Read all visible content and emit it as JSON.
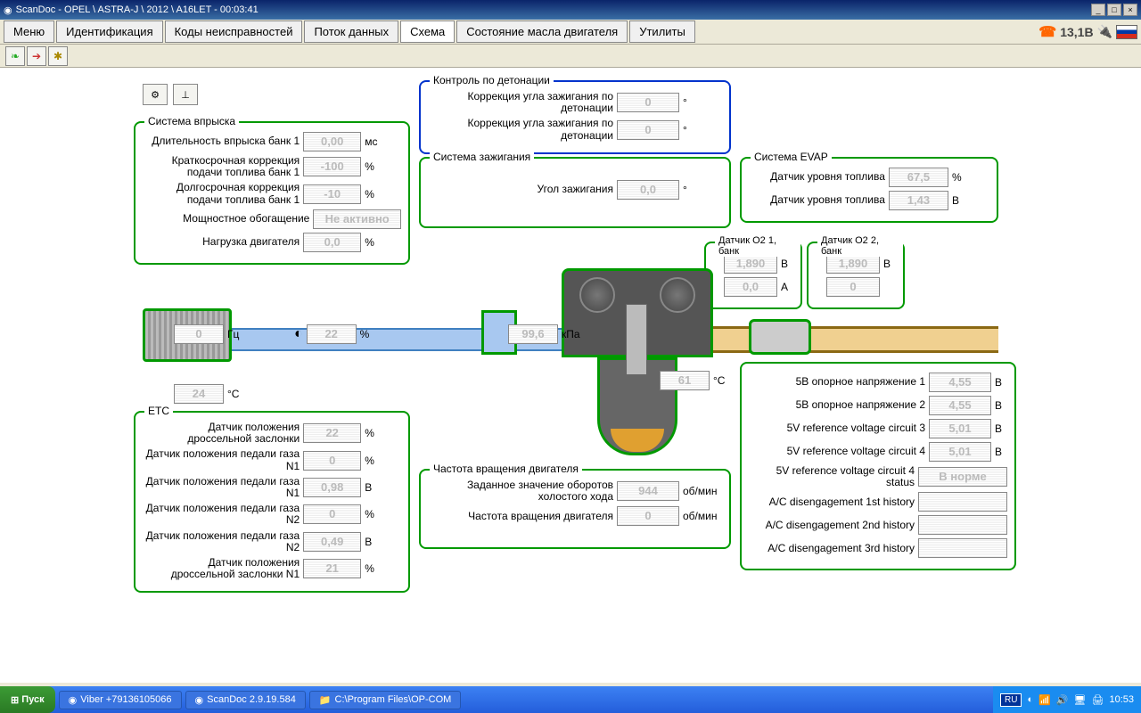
{
  "titlebar": "ScanDoc - OPEL \\ ASTRA-J \\ 2012 \\ A16LET - 00:03:41",
  "menu": {
    "items": [
      "Меню",
      "Идентификация",
      "Коды неисправностей",
      "Поток данных",
      "Схема",
      "Состояние масла двигателя",
      "Утилиты"
    ],
    "voltage": "13,1В"
  },
  "groups": {
    "knock": {
      "title": "Контроль по детонации",
      "r1_lbl": "Коррекция угла зажигания по детонации",
      "r1_val": "0",
      "r1_unit": "°",
      "r2_lbl": "Коррекция угла зажигания по детонации",
      "r2_val": "0",
      "r2_unit": "°"
    },
    "injection": {
      "title": "Система впрыска",
      "r1_lbl": "Длительность впрыска банк 1",
      "r1_val": "0,00",
      "r1_unit": "мс",
      "r2_lbl": "Краткосрочная коррекция подачи топлива банк 1",
      "r2_val": "-100",
      "r2_unit": "%",
      "r3_lbl": "Долгосрочная коррекция подачи топлива банк 1",
      "r3_val": "-10",
      "r3_unit": "%",
      "r4_lbl": "Мощностное обогащение",
      "r4_val": "Не активно",
      "r5_lbl": "Нагрузка двигателя",
      "r5_val": "0,0",
      "r5_unit": "%"
    },
    "ignition": {
      "title": "Система зажигания",
      "r1_lbl": "Угол зажигания",
      "r1_val": "0,0",
      "r1_unit": "°"
    },
    "evap": {
      "title": "Система EVAP",
      "r1_lbl": "Датчик уровня топлива",
      "r1_val": "67,5",
      "r1_unit": "%",
      "r2_lbl": "Датчик уровня топлива",
      "r2_val": "1,43",
      "r2_unit": "В"
    },
    "o2_1": {
      "title": "Датчик O2 1, банк",
      "r1_val": "1,890",
      "r1_unit": "В",
      "r2_val": "0,0",
      "r2_unit": "А"
    },
    "o2_2": {
      "title": "Датчик O2 2, банк",
      "r1_val": "1,890",
      "r1_unit": "В",
      "r2_val": "0"
    },
    "etc": {
      "title": "ETC",
      "r1_lbl": "Датчик положения дроссельной заслонки",
      "r1_val": "22",
      "r1_unit": "%",
      "r2_lbl": "Датчик положения педали газа N1",
      "r2_val": "0",
      "r2_unit": "%",
      "r3_lbl": "Датчик положения педали газа N1",
      "r3_val": "0,98",
      "r3_unit": "В",
      "r4_lbl": "Датчик положения педали газа N2",
      "r4_val": "0",
      "r4_unit": "%",
      "r5_lbl": "Датчик положения педали газа N2",
      "r5_val": "0,49",
      "r5_unit": "В",
      "r6_lbl": "Датчик положения дроссельной заслонки N1",
      "r6_val": "21",
      "r6_unit": "%"
    },
    "rpm": {
      "title": "Частота вращения двигателя",
      "r1_lbl": "Заданное значение оборотов холостого хода",
      "r1_val": "944",
      "r1_unit": "об/мин",
      "r2_lbl": "Частота вращения двигателя",
      "r2_val": "0",
      "r2_unit": "об/мин"
    },
    "ref": {
      "r1_lbl": "5В опорное напряжение 1",
      "r1_val": "4,55",
      "r1_unit": "В",
      "r2_lbl": "5В опорное напряжение 2",
      "r2_val": "4,55",
      "r2_unit": "В",
      "r3_lbl": "5V reference voltage circuit 3",
      "r3_val": "5,01",
      "r3_unit": "В",
      "r4_lbl": "5V reference voltage circuit 4",
      "r4_val": "5,01",
      "r4_unit": "В",
      "r5_lbl": "5V reference voltage circuit 4 status",
      "r5_val": "В норме",
      "r6_lbl": "A/C disengagement 1st history",
      "r6_val": "",
      "r7_lbl": "A/C disengagement 2nd history",
      "r7_val": "",
      "r8_lbl": "A/C disengagement 3rd history",
      "r8_val": ""
    }
  },
  "floating": {
    "hz_val": "0",
    "hz_unit": "Гц",
    "pct_val": "22",
    "pct_unit": "%",
    "temp1_val": "24",
    "temp1_unit": "°C",
    "kpa_val": "99,6",
    "kpa_unit": "кПа",
    "temp2_val": "61",
    "temp2_unit": "°C"
  },
  "taskbar": {
    "start": "Пуск",
    "t1": "Viber +79136105066",
    "t2": "ScanDoc 2.9.19.584",
    "t3": "C:\\Program Files\\OP-COM",
    "lang": "RU",
    "clock": "10:53"
  }
}
